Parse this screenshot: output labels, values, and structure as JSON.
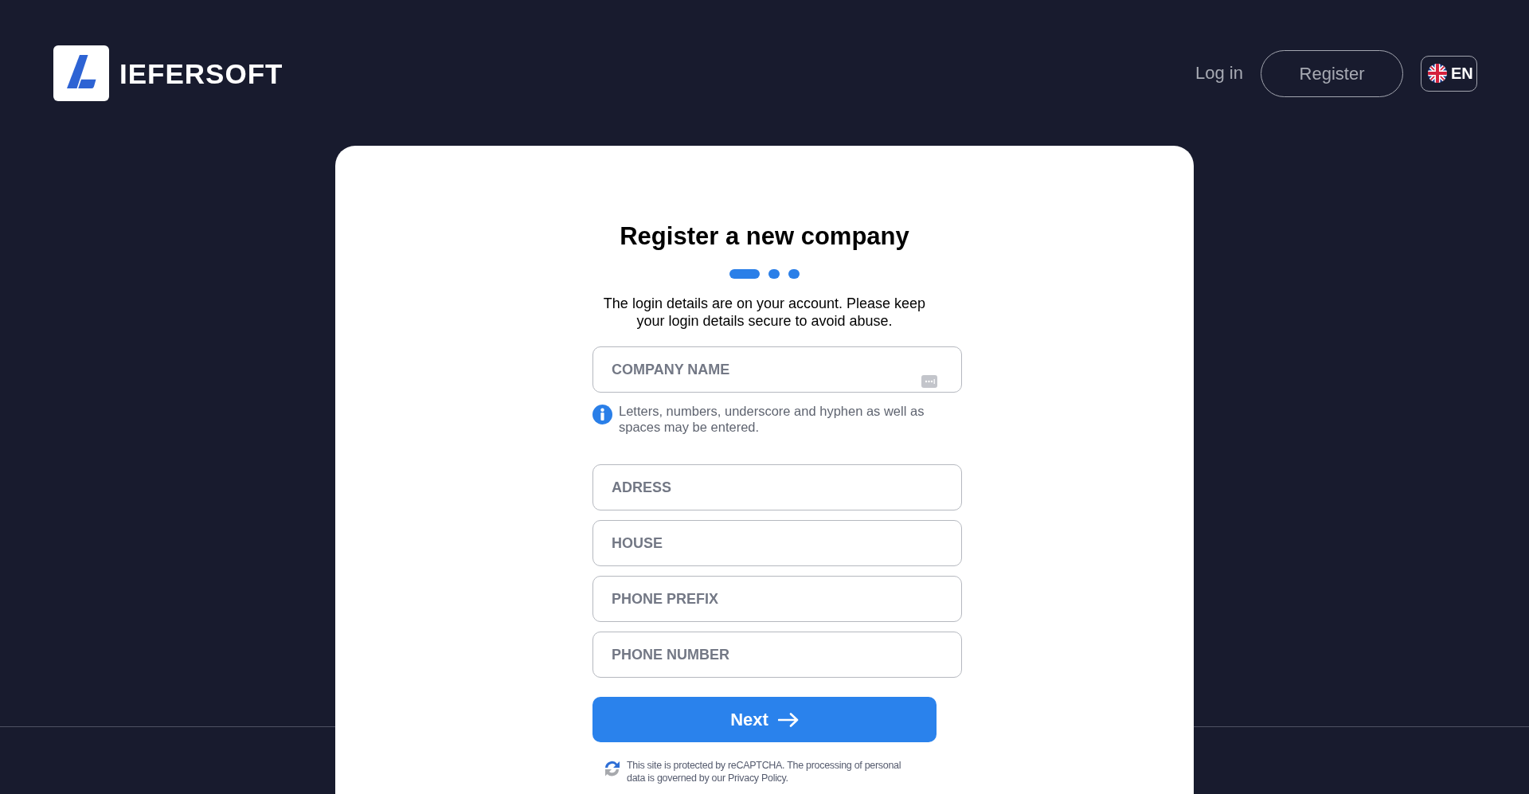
{
  "header": {
    "brand": "IEFERSOFT",
    "nav": [
      {
        "kind": "link",
        "label": "Log in"
      },
      {
        "kind": "outlined",
        "label": "Register"
      }
    ],
    "language": {
      "label": "EN"
    }
  },
  "card": {
    "title": "Register a new company",
    "steps": [
      {
        "kind": "current"
      },
      {
        "kind": "pending"
      },
      {
        "kind": "pending"
      }
    ],
    "description": "The login details are on your account. Please keep your login details secure to avoid abuse.",
    "fields": [
      {
        "placeholder": "COMPANY NAME",
        "autofill_icon": true,
        "hint": "Letters, numbers, underscore and hyphen as well as spaces may be entered."
      },
      {
        "placeholder": "ADRESS",
        "autofill_icon": false
      },
      {
        "placeholder": "HOUSE",
        "autofill_icon": false
      },
      {
        "placeholder": "PHONE PREFIX",
        "autofill_icon": false
      },
      {
        "placeholder": "PHONE NUMBER",
        "autofill_icon": false
      }
    ],
    "next_button": {
      "label": "Next"
    },
    "recaptcha_notice": "This site is protected by reCAPTCHA. The processing of personal data is governed by our Privacy Policy."
  }
}
